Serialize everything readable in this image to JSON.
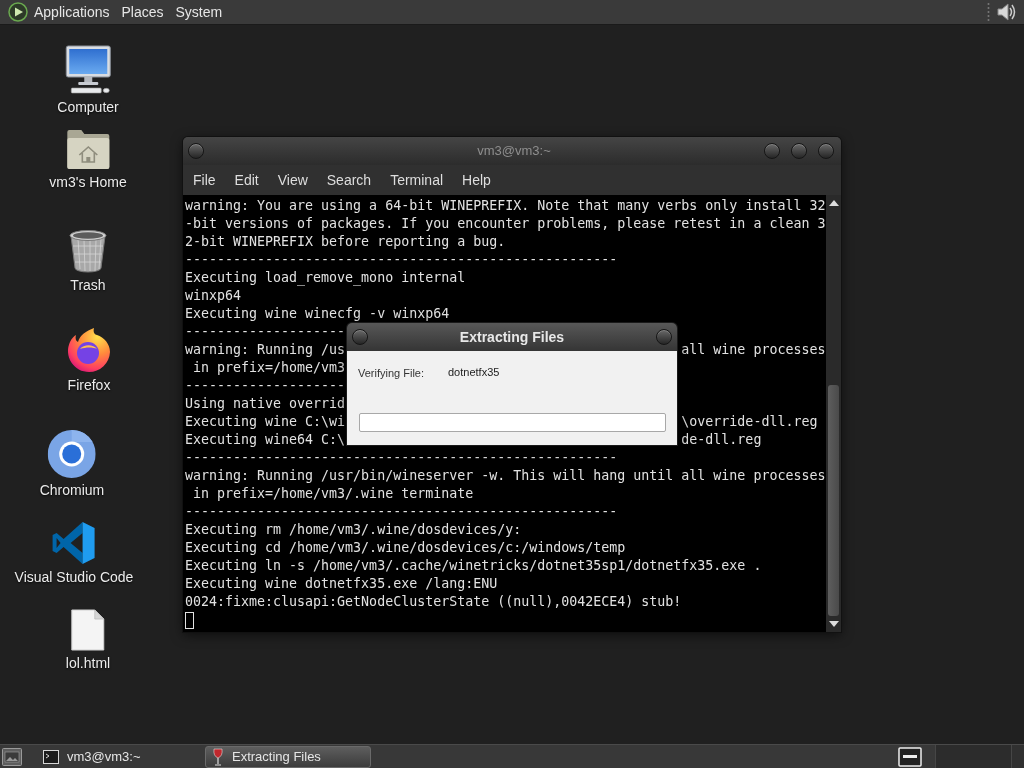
{
  "top_panel": {
    "menus": [
      "Applications",
      "Places",
      "System"
    ]
  },
  "desktop_icons": [
    {
      "label": "Computer",
      "kind": "computer"
    },
    {
      "label": "vm3's Home",
      "kind": "home_folder"
    },
    {
      "label": "Trash",
      "kind": "trash"
    },
    {
      "label": "Firefox",
      "kind": "flame_globe"
    },
    {
      "label": "Chromium",
      "kind": "ring_logo"
    },
    {
      "label": "Visual Studio Code",
      "kind": "ribbon_logo"
    },
    {
      "label": "lol.html",
      "kind": "document"
    }
  ],
  "terminal": {
    "title": "vm3@vm3:~",
    "menu": [
      "File",
      "Edit",
      "View",
      "Search",
      "Terminal",
      "Help"
    ],
    "lines": [
      {
        "kind": "full",
        "text": "warning: You are using a 64-bit WINEPREFIX. Note that many verbs only install 32"
      },
      {
        "kind": "full",
        "text": "-bit versions of packages. If you encounter problems, please retest in a clean 3"
      },
      {
        "kind": "full",
        "text": "2-bit WINEPREFIX before reporting a bug."
      },
      {
        "kind": "full",
        "text": "------------------------------------------------------"
      },
      {
        "kind": "full",
        "text": "Executing load_remove_mono internal"
      },
      {
        "kind": "full",
        "text": "winxp64"
      },
      {
        "kind": "full",
        "text": "Executing wine winecfg -v winxp64"
      },
      {
        "kind": "split",
        "left": "--------------------"
      },
      {
        "kind": "split",
        "left": "warning: Running /us",
        "right": "all wine processes"
      },
      {
        "kind": "split",
        "left": " in prefix=/home/vm3"
      },
      {
        "kind": "split",
        "left": "--------------------"
      },
      {
        "kind": "split",
        "left": "Using native overrid"
      },
      {
        "kind": "split",
        "left": "Executing wine C:\\wi",
        "right": "\\override-dll.reg"
      },
      {
        "kind": "split",
        "left": "Executing wine64 C:\\",
        "right": "de-dll.reg"
      },
      {
        "kind": "full",
        "text": "------------------------------------------------------"
      },
      {
        "kind": "full",
        "text": "warning: Running /usr/bin/wineserver -w. This will hang until all wine processes"
      },
      {
        "kind": "full",
        "text": " in prefix=/home/vm3/.wine terminate"
      },
      {
        "kind": "full",
        "text": "------------------------------------------------------"
      },
      {
        "kind": "full",
        "text": "Executing rm /home/vm3/.wine/dosdevices/y:"
      },
      {
        "kind": "full",
        "text": "Executing cd /home/vm3/.wine/dosdevices/c:/windows/temp"
      },
      {
        "kind": "full",
        "text": "Executing ln -s /home/vm3/.cache/winetricks/dotnet35sp1/dotnetfx35.exe ."
      },
      {
        "kind": "full",
        "text": "Executing wine dotnetfx35.exe /lang:ENU"
      },
      {
        "kind": "full",
        "text": "0024:fixme:clusapi:GetNodeClusterState ((null),0042ECE4) stub!"
      }
    ]
  },
  "extract_dialog": {
    "title": "Extracting Files",
    "field_label": "Verifying File:",
    "file_name": "dotnetfx35",
    "progress": {
      "level": 0
    }
  },
  "taskbar": {
    "tasks": [
      {
        "label": "vm3@vm3:~",
        "kind": "terminal",
        "selected": false
      },
      {
        "label": "Extracting Files",
        "kind": "wine",
        "selected": true
      }
    ]
  }
}
